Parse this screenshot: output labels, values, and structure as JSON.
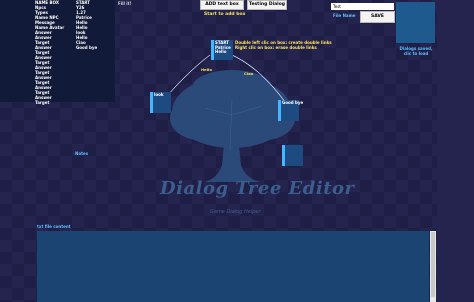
{
  "left_panel": {
    "col1_rows": [
      "NAME BOX",
      "Npcs",
      "Types",
      "Name NPC",
      "Message",
      "Name Avatar",
      "Answer",
      "Answer",
      "Target",
      "Answer",
      "Target",
      "Answer",
      "Target",
      "Answer",
      "Target",
      "Answer",
      "Target",
      "Answer",
      "Target",
      "Answer",
      "Target"
    ],
    "col2_rows": [
      "START",
      "Y26",
      "1.27",
      "Patrice",
      "Hello",
      "Hello",
      "look",
      "Hello",
      "Ciao",
      "Good bye"
    ]
  },
  "fill_label": "Fill it!",
  "toolbar": {
    "add_text_box": "ADD text box",
    "testing_dialog": "Testing Dialog",
    "hint": "Start to add box"
  },
  "file": {
    "name_value": "Test",
    "name_label": "File Name",
    "save_label": "SAVE",
    "saved_message": "Dialogs saved, clic to load"
  },
  "canvas_hint": [
    "Double left clic on box: create double links",
    "Right clic on box: erase double links"
  ],
  "nodes": {
    "start": [
      "START",
      "Patrice",
      "Hello"
    ],
    "look": [
      "look"
    ],
    "goodbye": [
      "Good bye"
    ],
    "empty": []
  },
  "connections": {
    "hello": "Hello",
    "ciao": "Ciao"
  },
  "notes_label": "Notes",
  "logo": {
    "title": "Dialog Tree Editor",
    "subtitle": "Game Dialog Helper"
  },
  "text_file_label": "txt file content",
  "colors": {
    "background": "#25244f",
    "panel": "#111a38",
    "node": "#1d4a80",
    "accent": "#41b8ff",
    "hint": "#ffe45c"
  }
}
